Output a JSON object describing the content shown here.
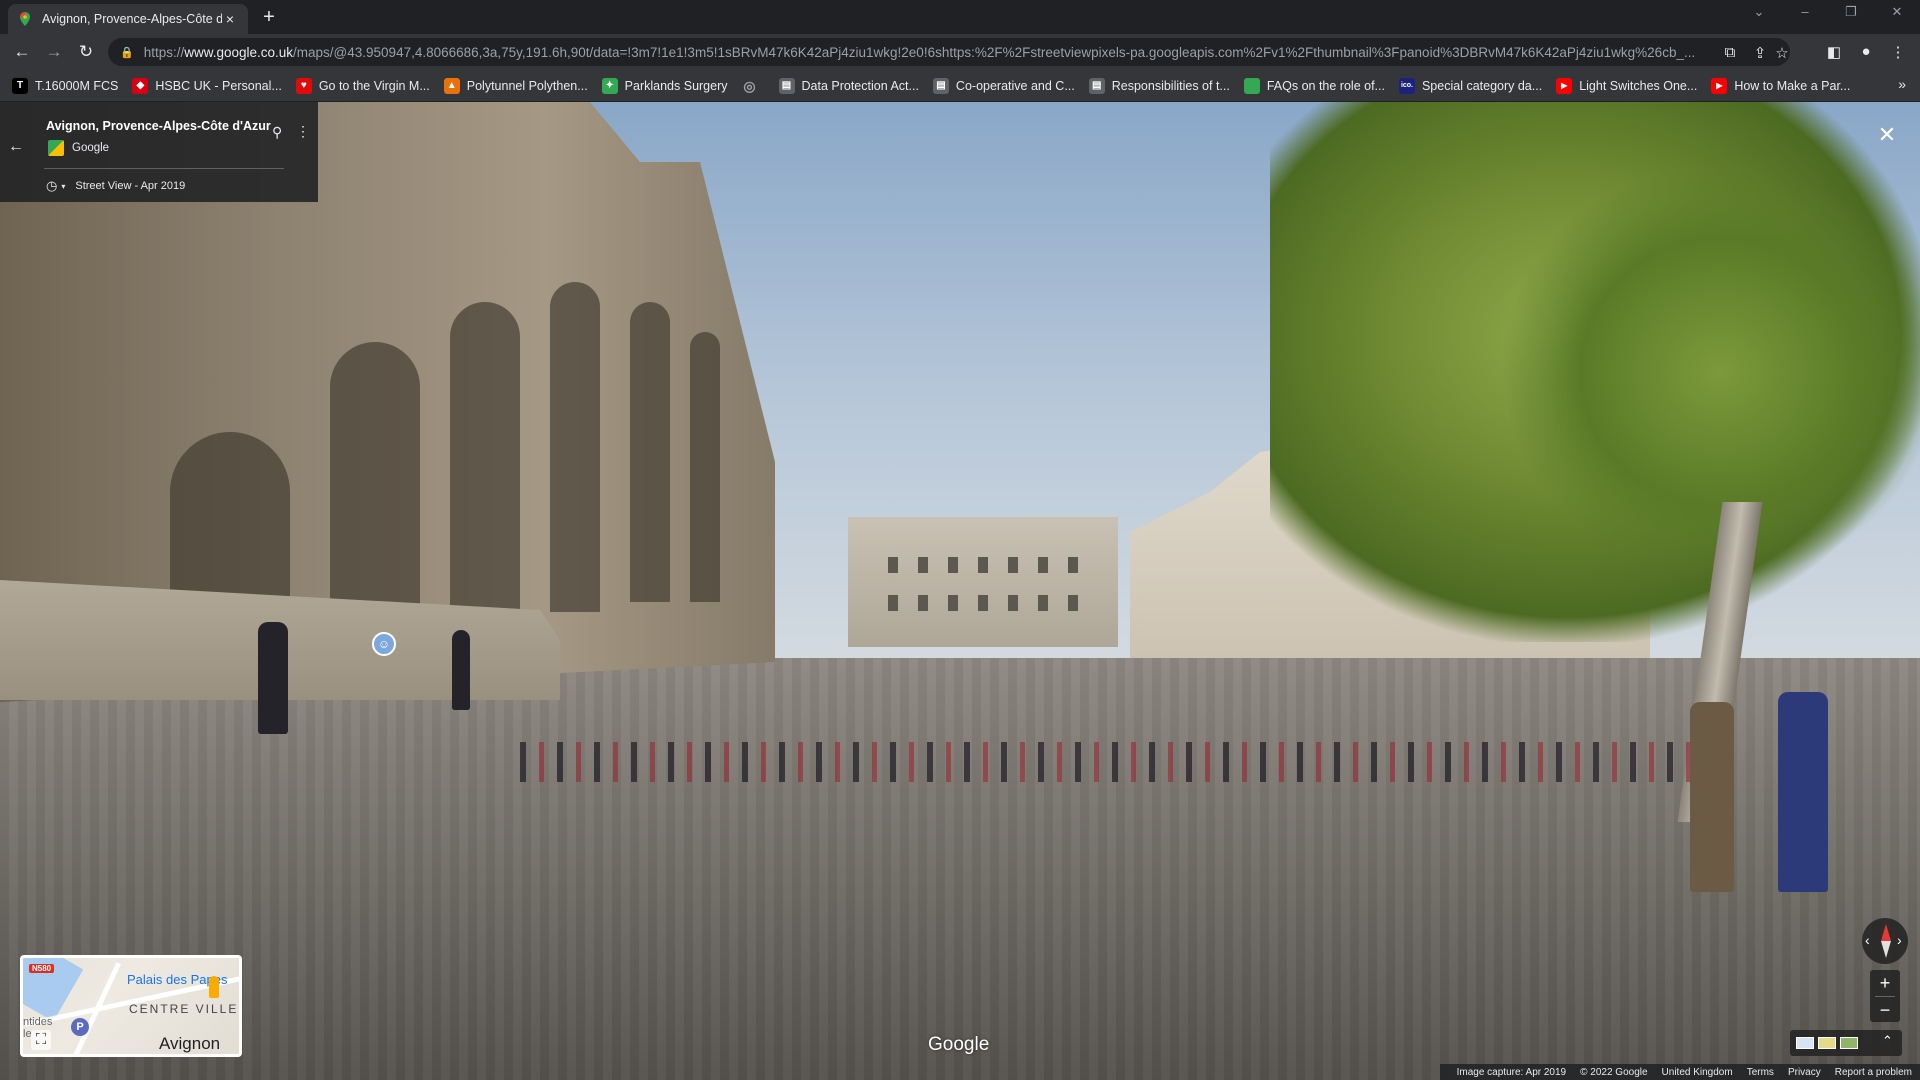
{
  "browser": {
    "tab_title": "Avignon, Provence-Alpes-Côte d",
    "tab_close": "×",
    "new_tab": "+",
    "url_prefix": "https://",
    "url_host": "www.google.co.uk",
    "url_path": "/maps/@43.950947,4.8066686,3a,75y,191.6h,90t/data=!3m7!1e1!3m5!1sBRvM47k6K42aPj4ziu1wkg!2e0!6shttps:%2F%2Fstreetviewpixels-pa.googleapis.com%2Fv1%2Fthumbnail%3Fpanoid%3DBRvM47k6K42aPj4ziu1wkg%26cb_...",
    "back": "←",
    "forward": "→",
    "reload": "↻",
    "lock": "🔒",
    "window_min": "–",
    "window_restore": "❐",
    "window_close": "✕",
    "tab_search": "⌄"
  },
  "bookmarks": [
    {
      "label": "T.16000M FCS",
      "icon": "T",
      "color": "#000000"
    },
    {
      "label": "HSBC UK - Personal...",
      "icon": "◆",
      "color": "#db0011"
    },
    {
      "label": "Go to the Virgin M...",
      "icon": "♥",
      "color": "#e10a0a"
    },
    {
      "label": "Polytunnel Polythen...",
      "icon": "▲",
      "color": "#e8710a"
    },
    {
      "label": "Parklands Surgery",
      "icon": "✦",
      "color": "#34a853"
    },
    {
      "label": "",
      "icon": "◎",
      "color": "#5f6368"
    },
    {
      "label": "Data Protection Act...",
      "icon": "▤",
      "color": "#5f6368"
    },
    {
      "label": "Co-operative and C...",
      "icon": "▤",
      "color": "#5f6368"
    },
    {
      "label": "Responsibilities of t...",
      "icon": "▤",
      "color": "#5f6368"
    },
    {
      "label": "FAQs on the role of...",
      "icon": "■",
      "color": "#34a853"
    },
    {
      "label": "Special category da...",
      "icon": "ico.",
      "color": "#1a237e"
    },
    {
      "label": "Light Switches One...",
      "icon": "▶",
      "color": "#ff0000"
    },
    {
      "label": "How to Make a Par...",
      "icon": "▶",
      "color": "#ff0000"
    }
  ],
  "bookmarks_more": "»",
  "panel": {
    "back_icon": "←",
    "title": "Avignon, Provence-Alpes-Côte d'Azur",
    "source": "Google",
    "pin_icon": "⚲",
    "more_icon": "⋮",
    "clock_icon": "◷",
    "caret_icon": "▾",
    "date_label": "Street View - Apr 2019"
  },
  "streetview": {
    "close_icon": "✕",
    "marker_icon": "☺",
    "watermark": "Google"
  },
  "minimap": {
    "road_badge": "N580",
    "poi": "Palais des Papes",
    "district": "CENTRE VILLE",
    "city": "Avignon",
    "left_label": "ntides\nle",
    "parking_icon": "P",
    "expand_icon": "⛶"
  },
  "controls": {
    "zoom_in": "+",
    "zoom_out": "−",
    "compass_left": "‹",
    "compass_right": "›",
    "layers_chevron": "⌃"
  },
  "footer": {
    "capture": "Image capture: Apr 2019",
    "copyright": "© 2022 Google",
    "region": "United Kingdom",
    "terms": "Terms",
    "privacy": "Privacy",
    "report": "Report a problem"
  }
}
